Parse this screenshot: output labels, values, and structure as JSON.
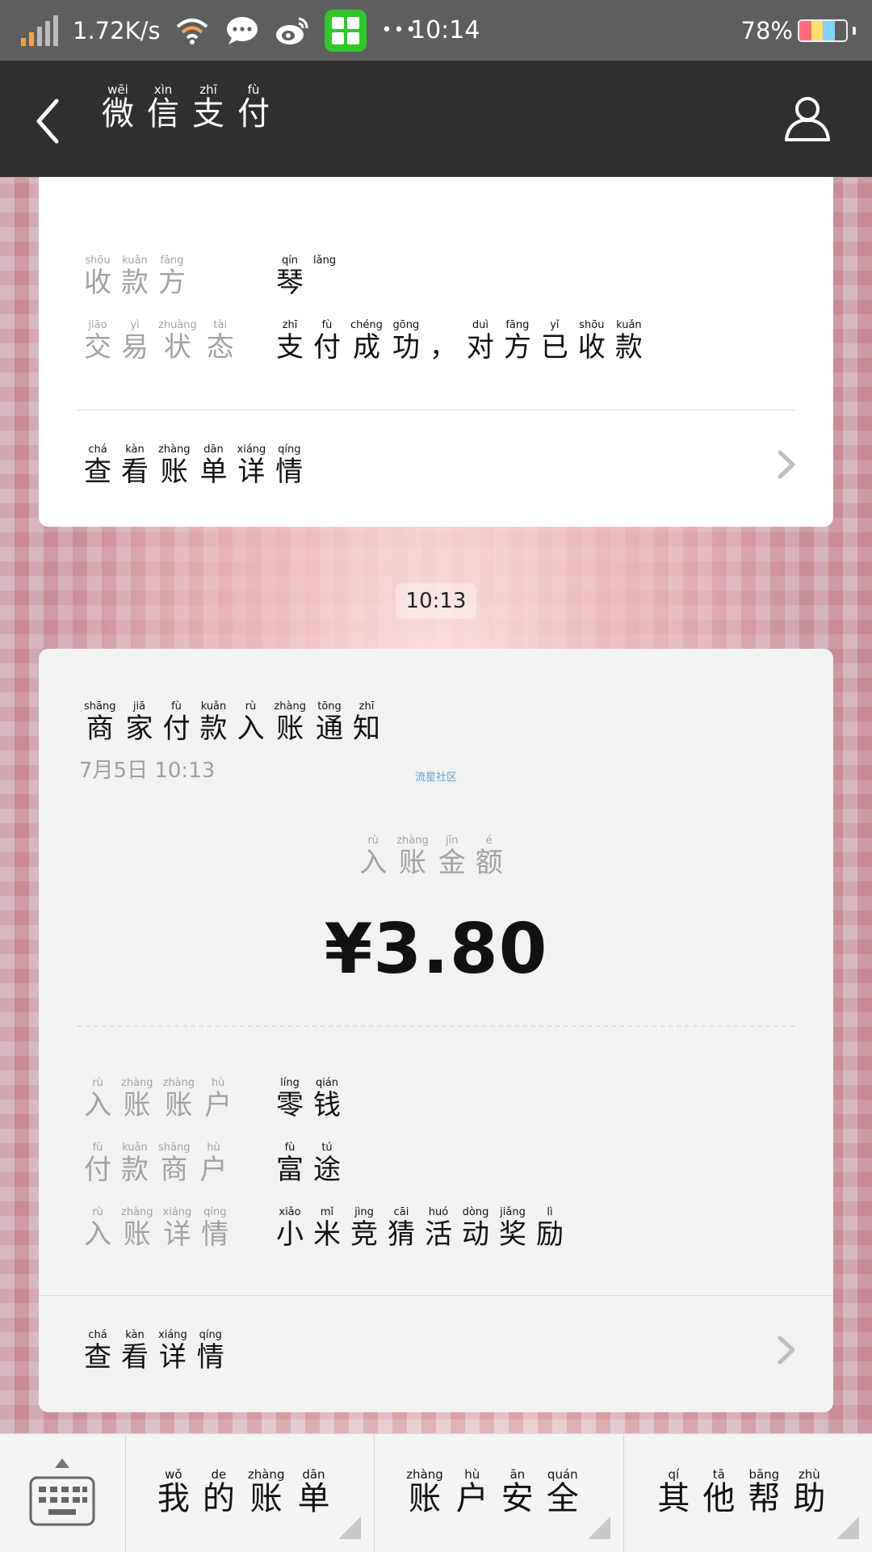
{
  "status_bar": {
    "speed": "1.72K/s",
    "time": "10:14",
    "battery": "78%",
    "more": "•••"
  },
  "header": {
    "title": [
      {
        "py": "wēi",
        "hz": "微"
      },
      {
        "py": "xìn",
        "hz": "信"
      },
      {
        "py": "zhī",
        "hz": "支"
      },
      {
        "py": "fù",
        "hz": "付"
      }
    ]
  },
  "card1": {
    "payee_label": [
      {
        "py": "shōu",
        "hz": "收"
      },
      {
        "py": "kuǎn",
        "hz": "款"
      },
      {
        "py": "fāng",
        "hz": "方"
      }
    ],
    "payee_value": [
      {
        "py": "qín",
        "hz": "琴"
      },
      {
        "py": "lǎng",
        "hz": ""
      }
    ],
    "status_label": [
      {
        "py": "jiāo",
        "hz": "交"
      },
      {
        "py": "yì",
        "hz": "易"
      },
      {
        "py": "zhuàng",
        "hz": "状"
      },
      {
        "py": "tài",
        "hz": "态"
      }
    ],
    "status_value": [
      {
        "py": "zhī",
        "hz": "支"
      },
      {
        "py": "fù",
        "hz": "付"
      },
      {
        "py": "chéng",
        "hz": "成"
      },
      {
        "py": "gōng",
        "hz": "功"
      },
      {
        "py": "",
        "hz": "，"
      },
      {
        "py": "duì",
        "hz": "对"
      },
      {
        "py": "fāng",
        "hz": "方"
      },
      {
        "py": "yǐ",
        "hz": "已"
      },
      {
        "py": "shōu",
        "hz": "收"
      },
      {
        "py": "kuǎn",
        "hz": "款"
      }
    ],
    "view_bill": [
      {
        "py": "chá",
        "hz": "查"
      },
      {
        "py": "kàn",
        "hz": "看"
      },
      {
        "py": "zhàng",
        "hz": "账"
      },
      {
        "py": "dān",
        "hz": "单"
      },
      {
        "py": "xiáng",
        "hz": "详"
      },
      {
        "py": "qíng",
        "hz": "情"
      }
    ]
  },
  "timestamp_chip": "10:13",
  "card2": {
    "title": [
      {
        "py": "shāng",
        "hz": "商"
      },
      {
        "py": "jiā",
        "hz": "家"
      },
      {
        "py": "fù",
        "hz": "付"
      },
      {
        "py": "kuǎn",
        "hz": "款"
      },
      {
        "py": "rù",
        "hz": "入"
      },
      {
        "py": "zhàng",
        "hz": "账"
      },
      {
        "py": "tōng",
        "hz": "通"
      },
      {
        "py": "zhī",
        "hz": "知"
      }
    ],
    "date": "7月5日   10:13",
    "watermark": "流星社区",
    "amount_label": [
      {
        "py": "rù",
        "hz": "入"
      },
      {
        "py": "zhàng",
        "hz": "账"
      },
      {
        "py": "jīn",
        "hz": "金"
      },
      {
        "py": "é",
        "hz": "额"
      }
    ],
    "amount": "¥3.80",
    "rows": [
      {
        "label": [
          {
            "py": "rù",
            "hz": "入"
          },
          {
            "py": "zhàng",
            "hz": "账"
          },
          {
            "py": "zhàng",
            "hz": "账"
          },
          {
            "py": "hù",
            "hz": "户"
          }
        ],
        "value": [
          {
            "py": "líng",
            "hz": "零"
          },
          {
            "py": "qián",
            "hz": "钱"
          }
        ]
      },
      {
        "label": [
          {
            "py": "fù",
            "hz": "付"
          },
          {
            "py": "kuǎn",
            "hz": "款"
          },
          {
            "py": "shāng",
            "hz": "商"
          },
          {
            "py": "hù",
            "hz": "户"
          }
        ],
        "value": [
          {
            "py": "fù",
            "hz": "富"
          },
          {
            "py": "tú",
            "hz": "途"
          }
        ]
      },
      {
        "label": [
          {
            "py": "rù",
            "hz": "入"
          },
          {
            "py": "zhàng",
            "hz": "账"
          },
          {
            "py": "xiáng",
            "hz": "详"
          },
          {
            "py": "qíng",
            "hz": "情"
          }
        ],
        "value": [
          {
            "py": "xiǎo",
            "hz": "小"
          },
          {
            "py": "mǐ",
            "hz": "米"
          },
          {
            "py": "jìng",
            "hz": "竞"
          },
          {
            "py": "cāi",
            "hz": "猜"
          },
          {
            "py": "huó",
            "hz": "活"
          },
          {
            "py": "dòng",
            "hz": "动"
          },
          {
            "py": "jiǎng",
            "hz": "奖"
          },
          {
            "py": "lì",
            "hz": "励"
          }
        ]
      }
    ],
    "view_details": [
      {
        "py": "chá",
        "hz": "查"
      },
      {
        "py": "kàn",
        "hz": "看"
      },
      {
        "py": "xiáng",
        "hz": "详"
      },
      {
        "py": "qíng",
        "hz": "情"
      }
    ]
  },
  "bottom_menu": [
    [
      {
        "py": "wǒ",
        "hz": "我"
      },
      {
        "py": "de",
        "hz": "的"
      },
      {
        "py": "zhàng",
        "hz": "账"
      },
      {
        "py": "dān",
        "hz": "单"
      }
    ],
    [
      {
        "py": "zhàng",
        "hz": "账"
      },
      {
        "py": "hù",
        "hz": "户"
      },
      {
        "py": "ān",
        "hz": "安"
      },
      {
        "py": "quán",
        "hz": "全"
      }
    ],
    [
      {
        "py": "qí",
        "hz": "其"
      },
      {
        "py": "tā",
        "hz": "他"
      },
      {
        "py": "bāng",
        "hz": "帮"
      },
      {
        "py": "zhù",
        "hz": "助"
      }
    ]
  ],
  "colors": {
    "header_bg": "#2f2f2f",
    "statusbar_bg": "#5e5e5e",
    "label_gray": "#a2a2a2",
    "text_dark": "#111111",
    "wechat_green": "#31c72b"
  }
}
